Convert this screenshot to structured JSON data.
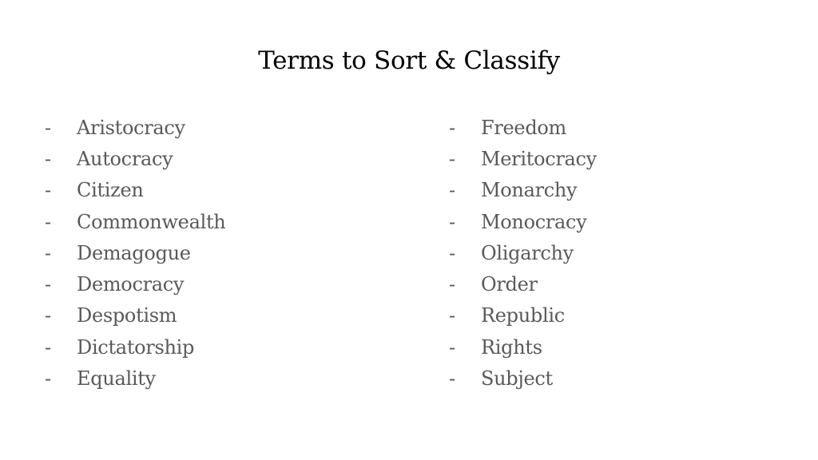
{
  "slide": {
    "title": "Terms to Sort & Classify",
    "bullet": "-",
    "left_column": [
      "Aristocracy",
      "Autocracy",
      "Citizen",
      "Commonwealth",
      "Demagogue",
      "Democracy",
      "Despotism",
      "Dictatorship",
      "Equality"
    ],
    "right_column": [
      "Freedom",
      "Meritocracy",
      "Monarchy",
      "Monocracy",
      "Oligarchy",
      "Order",
      "Republic",
      "Rights",
      "Subject"
    ],
    "colors": {
      "title": "#000000",
      "body_text": "#595959",
      "background": "#ffffff"
    }
  }
}
